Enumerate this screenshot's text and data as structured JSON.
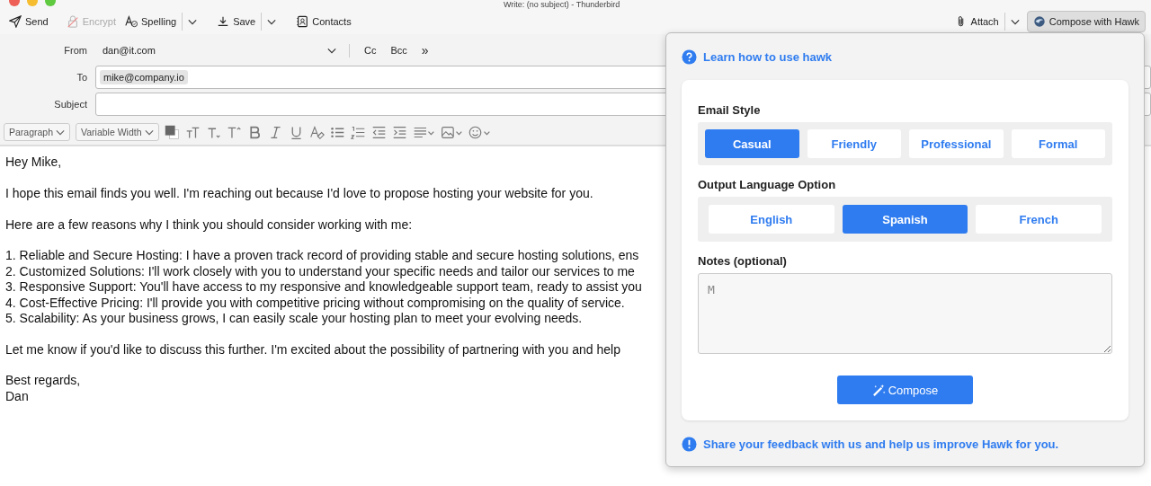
{
  "window": {
    "title": "Write: (no subject) - Thunderbird"
  },
  "toolbar": {
    "left": [
      {
        "label": "Send",
        "kind": "send",
        "disabled": false
      },
      {
        "label": "Encrypt",
        "kind": "encrypt",
        "disabled": true
      },
      {
        "label": "Spelling",
        "kind": "spelling",
        "disabled": false,
        "menu": true
      },
      {
        "label": "Save",
        "kind": "save",
        "disabled": false,
        "menu": true
      },
      {
        "label": "Contacts",
        "kind": "contacts",
        "disabled": false
      }
    ],
    "right": [
      {
        "label": "Attach",
        "kind": "attach",
        "disabled": false,
        "menu": true
      },
      {
        "label": "Compose with Hawk",
        "kind": "hawk",
        "disabled": false
      }
    ]
  },
  "header": {
    "from_label": "From",
    "from_value": "dan@it.com",
    "cc": "Cc",
    "bcc": "Bcc",
    "more": "»",
    "to_label": "To",
    "to_recipients": [
      "mike@company.io"
    ],
    "subject_label": "Subject"
  },
  "format_bar": {
    "paragraph": "Paragraph",
    "font": "Variable Width"
  },
  "body": [
    {
      "lines": [
        "Hey Mike,"
      ]
    },
    {
      "lines": [
        "I hope this email finds you well. I'm reaching out because I'd love to propose hosting your website for you."
      ]
    },
    {
      "lines": [
        "Here are a few reasons why I think you should consider working with me:"
      ]
    },
    {
      "lines": [
        "1. Reliable and Secure Hosting: I have a proven track record of providing stable and secure hosting solutions, ens",
        "2. Customized Solutions: I'll work closely with you to understand your specific needs and tailor our services to me",
        "3. Responsive Support: You'll have access to my responsive and knowledgeable support team, ready to assist you",
        "4. Cost-Effective Pricing: I'll provide you with competitive pricing without compromising on the quality of service.",
        "5. Scalability: As your business grows, I can easily scale your hosting plan to meet your evolving needs."
      ]
    },
    {
      "lines": [
        "Let me know if you'd like to discuss this further. I'm excited about the possibility of partnering with you and help"
      ]
    },
    {
      "lines": [
        "Best regards,",
        "Dan"
      ]
    }
  ],
  "hawk_panel": {
    "help_link": "Learn how to use hawk",
    "email_style": {
      "label": "Email Style",
      "options": [
        {
          "label": "Casual",
          "selected": true
        },
        {
          "label": "Friendly",
          "selected": false
        },
        {
          "label": "Professional",
          "selected": false
        },
        {
          "label": "Formal",
          "selected": false
        }
      ]
    },
    "language": {
      "label": "Output Language Option",
      "options": [
        {
          "label": "English",
          "selected": false
        },
        {
          "label": "Spanish",
          "selected": true
        },
        {
          "label": "French",
          "selected": false
        }
      ]
    },
    "notes": {
      "label": "Notes (optional)",
      "value": "M"
    },
    "compose_button": "Compose",
    "feedback_link": "Share your feedback with us and help us improve Hawk for you."
  }
}
